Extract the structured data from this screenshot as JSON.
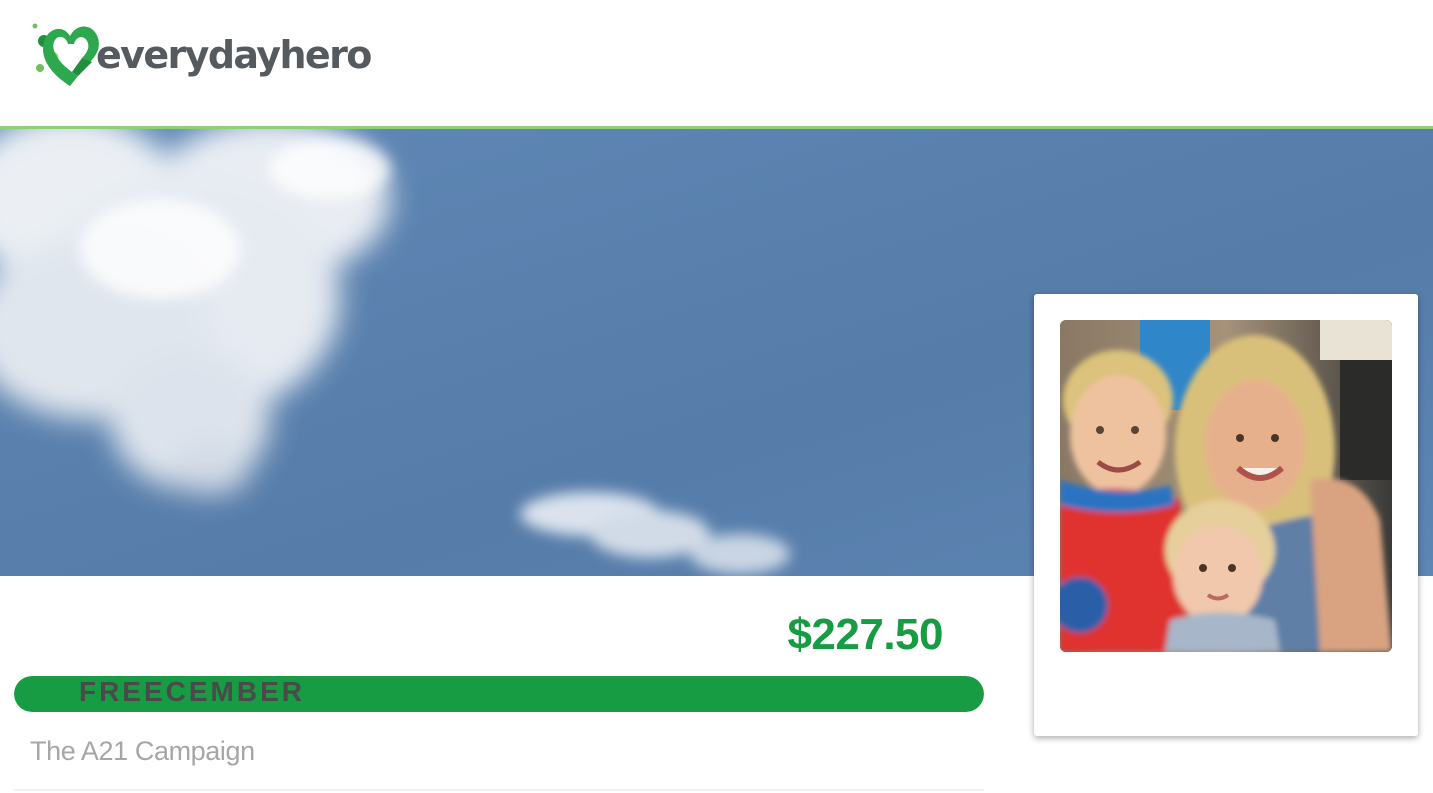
{
  "header": {
    "logo_text": "everydayhero",
    "logo_icon": "heart-logo-icon",
    "brand_color": "#2da84e",
    "accent_line_color": "#8fce7b"
  },
  "hero": {
    "image": "sky-with-heart-shaped-cloud",
    "sky_color": "#5b82b0"
  },
  "fundraising": {
    "amount_raised": "$227.50",
    "progress_percent": 100,
    "progress_color": "#179c43",
    "campaign_name": "The A21 Campaign"
  },
  "profile": {
    "photo": "family-selfie-photo",
    "name": "FREECEMBER"
  }
}
